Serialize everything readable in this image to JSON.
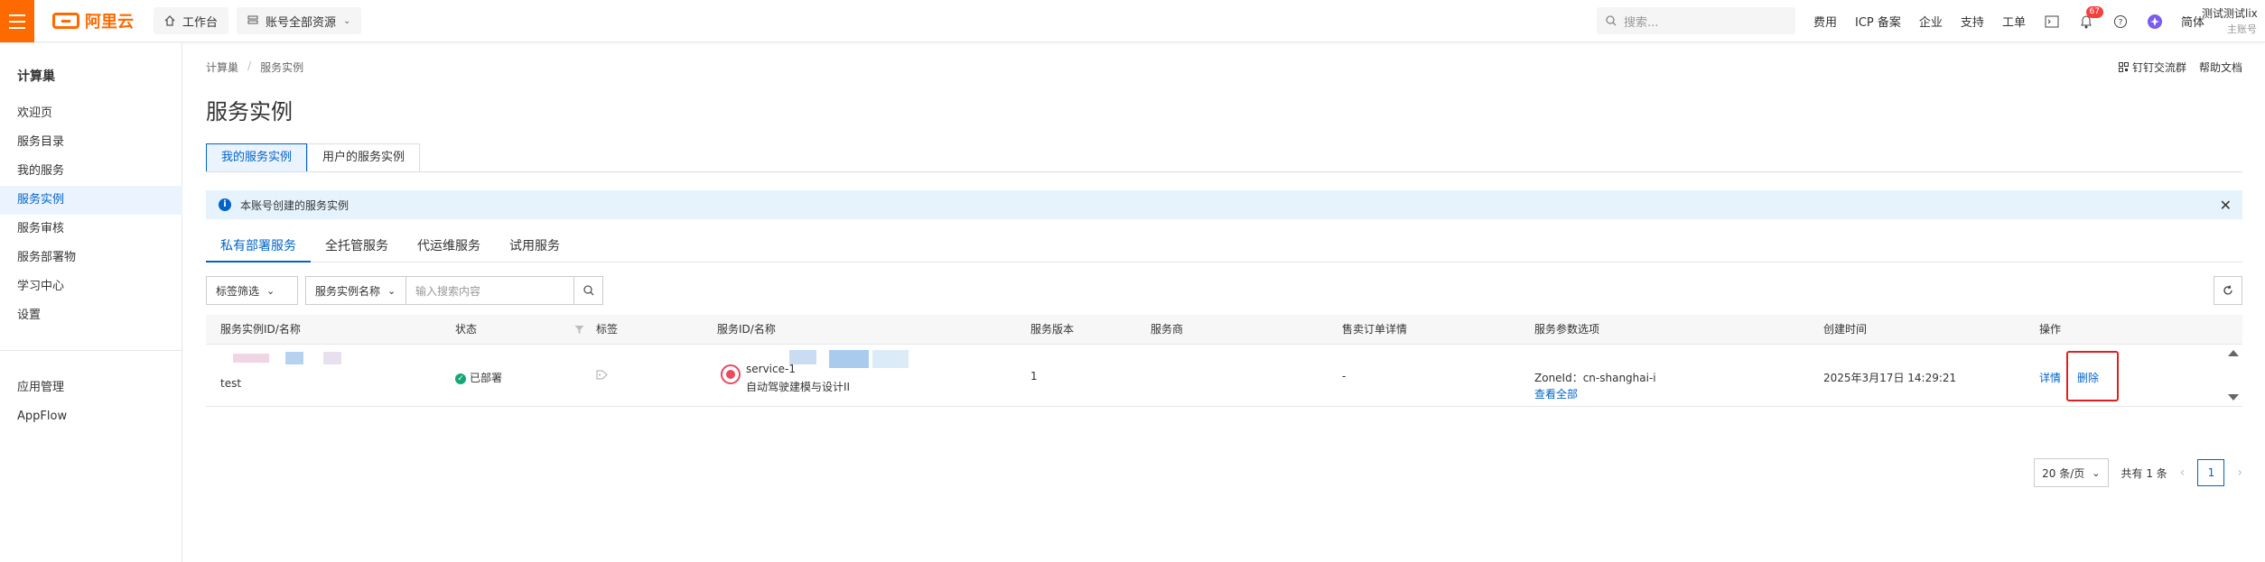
{
  "topbar": {
    "logo_text": "阿里云",
    "workbench": "工作台",
    "resource_scope": "账号全部资源",
    "search_placeholder": "搜索...",
    "links": [
      "费用",
      "ICP 备案",
      "企业",
      "支持",
      "工单"
    ],
    "notification_count": "67",
    "language": "简体",
    "user_name": "测试测试lix",
    "user_role": "主账号"
  },
  "sidebar": {
    "title": "计算巢",
    "items": [
      "欢迎页",
      "服务目录",
      "我的服务",
      "服务实例",
      "服务审核",
      "服务部署物",
      "学习中心",
      "设置"
    ],
    "active_index": 3,
    "bottom_items": [
      "应用管理",
      "AppFlow"
    ]
  },
  "main": {
    "breadcrumb": [
      "计算巢",
      "服务实例"
    ],
    "title": "服务实例",
    "top_right": [
      "钉钉交流群",
      "帮助文档"
    ],
    "tabs": [
      "我的服务实例",
      "用户的服务实例"
    ],
    "alert": "本账号创建的服务实例",
    "subtabs": [
      "私有部署服务",
      "全托管服务",
      "代运维服务",
      "试用服务"
    ],
    "filters": {
      "tag_filter": "标签筛选",
      "field_select": "服务实例名称",
      "search_placeholder": "输入搜索内容"
    },
    "table": {
      "headers": [
        "服务实例ID/名称",
        "状态",
        "标签",
        "服务ID/名称",
        "服务版本",
        "服务商",
        "售卖订单详情",
        "服务参数选项",
        "创建时间",
        "操作"
      ],
      "rows": [
        {
          "instance_name": "test",
          "status": "已部署",
          "service_id": "service-1",
          "service_name": "自动驾驶建模与设计II",
          "version": "1",
          "provider": "",
          "order": "-",
          "params": "ZoneId：cn-shanghai-i",
          "params_more": "查看全部",
          "created": "2025年3月17日 14:29:21",
          "action_detail": "详情",
          "action_delete": "删除"
        }
      ]
    },
    "pagination": {
      "page_size": "20 条/页",
      "total": "共有 1 条",
      "current_page": "1"
    }
  },
  "colors": {
    "brand": "#ff6a00",
    "primary": "#0064c8",
    "success": "#15a675",
    "highlight": "#e02020"
  }
}
